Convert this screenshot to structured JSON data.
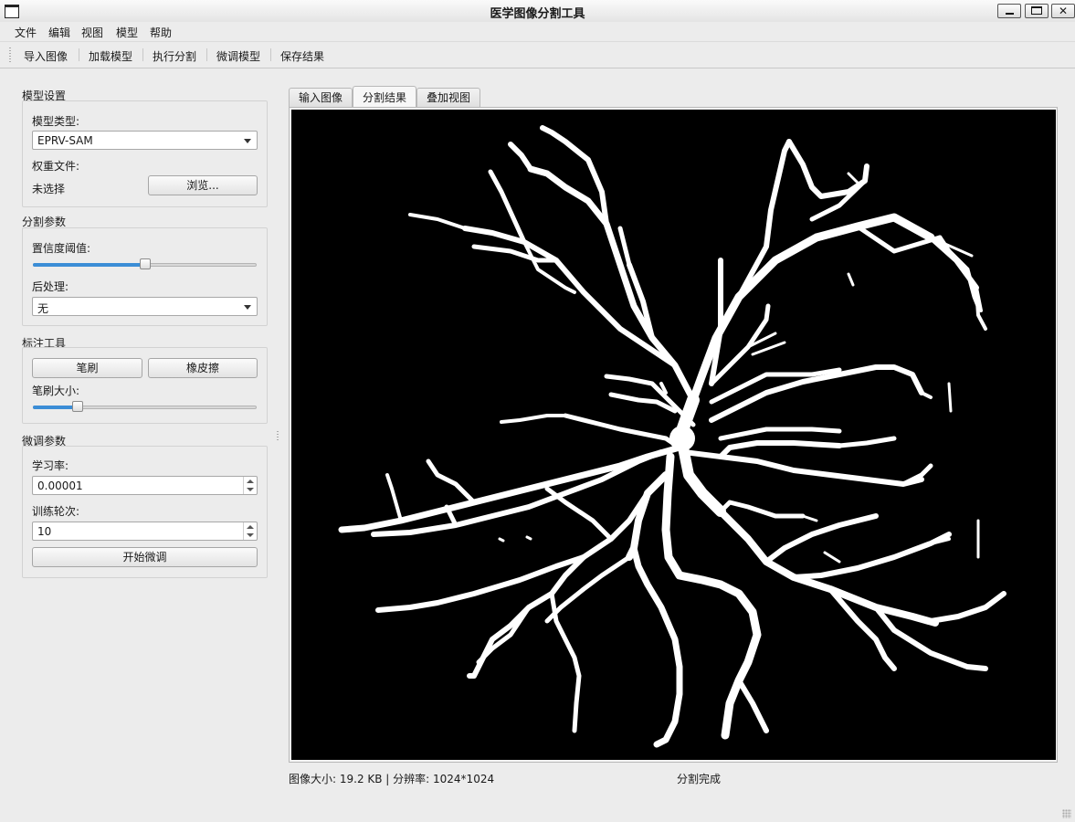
{
  "window": {
    "title": "医学图像分割工具",
    "controls": [
      "minimize",
      "maximize",
      "close"
    ]
  },
  "menu": [
    "文件",
    "编辑",
    "视图",
    "模型",
    "帮助"
  ],
  "toolbar": [
    "导入图像",
    "加载模型",
    "执行分割",
    "微调模型",
    "保存结果"
  ],
  "model_settings": {
    "section": "模型设置",
    "model_type_label": "模型类型:",
    "model_type_value": "EPRV-SAM",
    "weights_label": "权重文件:",
    "weights_value": "未选择",
    "browse_label": "浏览..."
  },
  "seg_params": {
    "section": "分割参数",
    "confidence_label": "置信度阈值:",
    "confidence_level": 0.5,
    "postprocess_label": "后处理:",
    "postprocess_value": "无"
  },
  "annotation": {
    "section": "标注工具",
    "brush_label": "笔刷",
    "eraser_label": "橡皮擦",
    "brush_size_label": "笔刷大小:",
    "brush_size_level": 0.2
  },
  "finetune": {
    "section": "微调参数",
    "lr_label": "学习率:",
    "lr_value": "0.00001",
    "epochs_label": "训练轮次:",
    "epochs_value": "10",
    "start_label": "开始微调"
  },
  "tabs": [
    "输入图像",
    "分割结果",
    "叠加视图"
  ],
  "active_tab": 1,
  "status": {
    "info": "图像大小: 19.2 KB | 分辨率: 1024*1024",
    "message": "分割完成"
  },
  "colors": {
    "slider_fill": "#3b8dd6",
    "image_background": "#000000",
    "vessel": "#ffffff"
  }
}
